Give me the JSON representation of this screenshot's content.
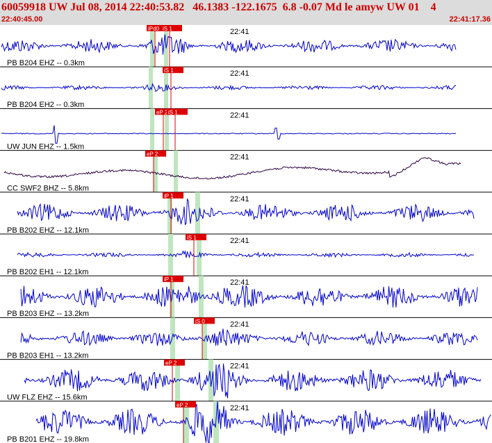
{
  "header": {
    "event_line": "60059918 UW Jul 08, 2014 22:40:53.82   46.1383 -122.1675  6.8 -0.07 Md le amyw UW 01    4",
    "start_time": "22:40:45.00",
    "end_time": "22:41:17.36"
  },
  "colors": {
    "header_bg": "#dcdcdc",
    "header_text": "#cc0000",
    "trace_blue": "#0000cc",
    "trace_dark": "#2a0040",
    "pick_red": "#dd0000",
    "window_green": "#bfe6bf",
    "separator": "#000000"
  },
  "time_marker": "22:41",
  "traces": [
    {
      "label": "PB B204 EHZ -- 0.3km",
      "picks": [
        "iPd0",
        "iS 1"
      ],
      "color": "blue",
      "amp": 0.45,
      "style": "noise"
    },
    {
      "label": "PB B204 EH2 -- 0.3km",
      "picks": [
        "iS 1"
      ],
      "color": "blue",
      "amp": 0.15,
      "style": "noise"
    },
    {
      "label": "UW JUN EHZ -- 1.5km",
      "picks": [
        "eP 2",
        "iS 1"
      ],
      "color": "blue",
      "amp": 0.02,
      "style": "flat"
    },
    {
      "label": "CC SWF2 BHZ -- 5.8km",
      "picks": [
        "eP 2"
      ],
      "color": "dark",
      "amp": 0.35,
      "style": "wave"
    },
    {
      "label": "PB B202 EHZ -- 12.1km",
      "picks": [
        "iP 1"
      ],
      "color": "blue",
      "amp": 0.6,
      "style": "noise"
    },
    {
      "label": "PB B202 EH1 -- 12.1km",
      "picks": [
        "iS 1"
      ],
      "color": "blue",
      "amp": 0.15,
      "style": "noise"
    },
    {
      "label": "PB B203 EHZ -- 13.2km",
      "picks": [
        "iP 1"
      ],
      "color": "blue",
      "amp": 0.75,
      "style": "noise"
    },
    {
      "label": "PB B203 EH1 -- 13.2km",
      "picks": [
        "iS 0"
      ],
      "color": "blue",
      "amp": 0.5,
      "style": "noise"
    },
    {
      "label": "UW FLZ EHZ -- 15.6km",
      "picks": [
        "eP 2"
      ],
      "color": "blue",
      "amp": 0.75,
      "style": "noise"
    },
    {
      "label": "PB B201 EHZ -- 19.8km",
      "picks": [
        "eP 2"
      ],
      "color": "blue",
      "amp": 0.9,
      "style": "noise"
    }
  ]
}
